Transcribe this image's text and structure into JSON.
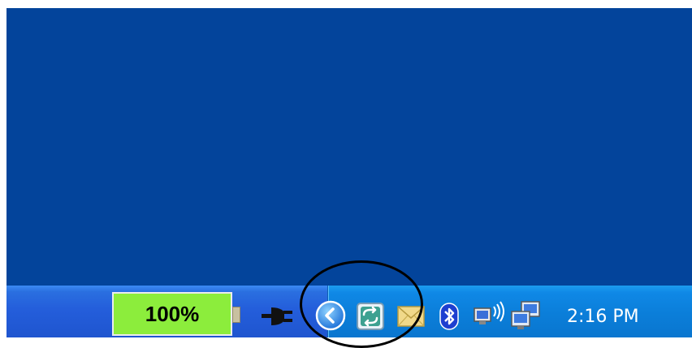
{
  "battery": {
    "label": "100%",
    "level_percent": 100,
    "color": "#8ced3c"
  },
  "tray": {
    "icons": [
      "power-plug-icon",
      "chevron-left-icon",
      "sync-icon",
      "mail-icon",
      "bluetooth-icon",
      "wireless-network-icon",
      "network-icon"
    ]
  },
  "clock": {
    "time": "2:16 PM"
  },
  "colors": {
    "desktop": "#03449b",
    "taskbar": "#245edb",
    "tray": "#0b7ed9"
  }
}
